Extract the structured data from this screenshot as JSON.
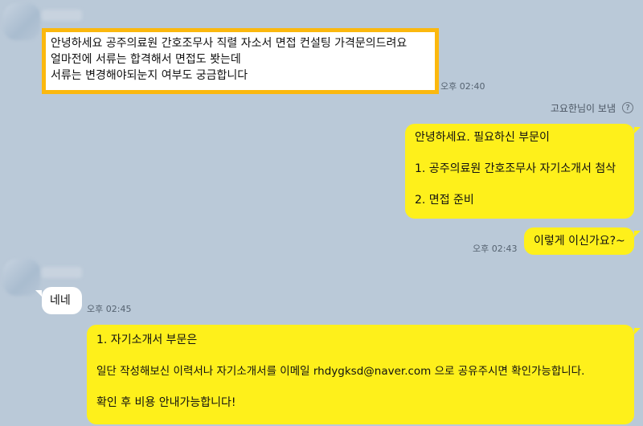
{
  "messages": {
    "m1": {
      "lines": [
        "안녕하세요 공주의료원 간호조무사 직렬 자소서 면접 컨설팅 가격문의드려요",
        "얼마전에 서류는 합격해서 면접도 봣는데",
        "서류는 변경해야되눈지 여부도 궁금합니다"
      ],
      "time": "오후 02:40"
    },
    "sender_label": "고요한님이 보냄",
    "help_glyph": "?",
    "m2": {
      "lines": [
        "안녕하세요. 필요하신 부문이",
        "1. 공주의료원 간호조무사 자기소개서 첨삭",
        "2. 면접 준비"
      ]
    },
    "m3": {
      "text": "이렇게 이신가요?~",
      "time": "오후 02:43"
    },
    "m4": {
      "text": "네네",
      "time": "오후 02:45"
    },
    "m5": {
      "lines": [
        "1. 자기소개서 부문은",
        "일단 작성해보신 이력서나 자기소개서를 이메일 rhdygksd@naver.com 으로 공유주시면 확인가능합니다.",
        "확인 후 비용 안내가능합니다!"
      ]
    }
  },
  "colors": {
    "background": "#bac9d8",
    "outgoing_bubble": "#fef01b",
    "incoming_bubble": "#ffffff",
    "highlight_border": "#fbb80e"
  }
}
